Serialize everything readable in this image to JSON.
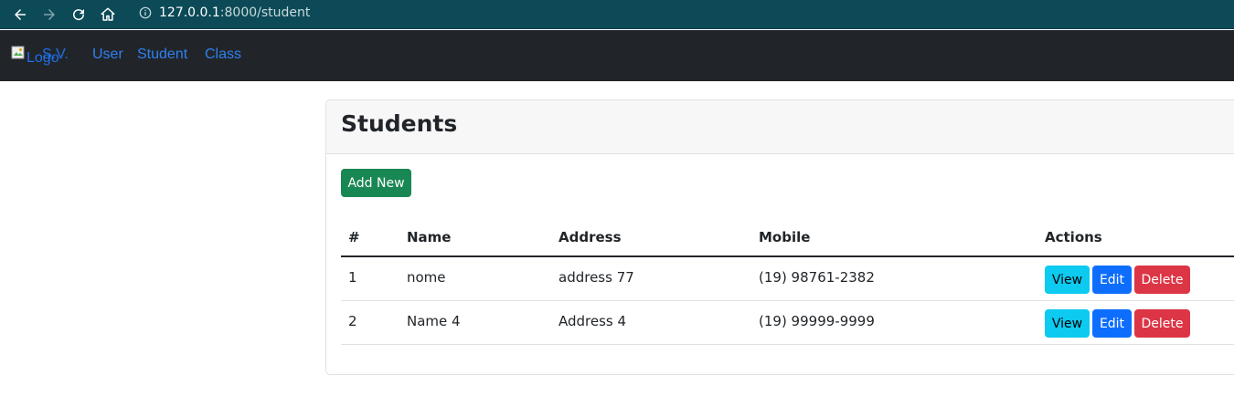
{
  "browser": {
    "url_host": "127.0.0.1",
    "url_rest": ":8000/student"
  },
  "navbar": {
    "brand_text": "S.V.",
    "brand_logo_alt": "Logo",
    "links": [
      "User",
      "Student",
      "Class"
    ]
  },
  "page": {
    "title": "Students",
    "add_button": "Add New"
  },
  "table": {
    "columns": [
      "#",
      "Name",
      "Address",
      "Mobile",
      "Actions"
    ],
    "rows": [
      {
        "num": "1",
        "name": "nome",
        "address": "address 77",
        "mobile": "(19) 98761-2382"
      },
      {
        "num": "2",
        "name": "Name 4",
        "address": "Address 4",
        "mobile": "(19) 99999-9999"
      }
    ],
    "actions": {
      "view": "View",
      "edit": "Edit",
      "delete": "Delete"
    }
  },
  "colors": {
    "browser_bar": "#0c4a57",
    "navbar": "#212529",
    "link": "#2f80f0",
    "success": "#198754",
    "info": "#0dcaf0",
    "primary": "#0d6efd",
    "danger": "#dc3545"
  },
  "icons": [
    "back-arrow-icon",
    "forward-arrow-icon",
    "reload-icon",
    "home-icon",
    "info-icon",
    "broken-image-icon"
  ]
}
